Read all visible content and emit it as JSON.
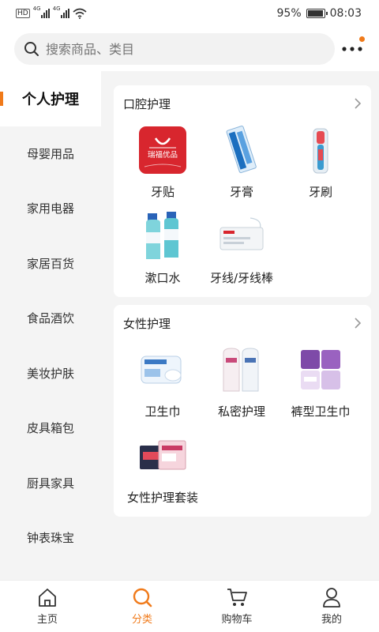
{
  "status": {
    "hd": "HD",
    "net1": "4G",
    "net2": "4G",
    "battery": "95%",
    "battery_level": 0.95,
    "time": "08:03"
  },
  "search": {
    "placeholder": "搜索商品、类目"
  },
  "sidebar": {
    "items": [
      {
        "label": "个人护理",
        "active": true
      },
      {
        "label": "母婴用品"
      },
      {
        "label": "家用电器"
      },
      {
        "label": "家居百货"
      },
      {
        "label": "食品酒饮"
      },
      {
        "label": "美妆护肤"
      },
      {
        "label": "皮具箱包"
      },
      {
        "label": "厨具家具"
      },
      {
        "label": "钟表珠宝"
      }
    ]
  },
  "sections": [
    {
      "title": "口腔护理",
      "items": [
        {
          "label": "牙贴",
          "icon": "tooth-strip-product-icon",
          "brand": "瑞福优品"
        },
        {
          "label": "牙膏",
          "icon": "toothpaste-product-icon"
        },
        {
          "label": "牙刷",
          "icon": "toothbrush-product-icon"
        },
        {
          "label": "漱口水",
          "icon": "mouthwash-product-icon"
        },
        {
          "label": "牙线/牙线棒",
          "icon": "dental-floss-product-icon"
        }
      ]
    },
    {
      "title": "女性护理",
      "items": [
        {
          "label": "卫生巾",
          "icon": "sanitary-pad-product-icon"
        },
        {
          "label": "私密护理",
          "icon": "intimate-care-product-icon"
        },
        {
          "label": "裤型卫生巾",
          "icon": "pants-pad-product-icon"
        },
        {
          "label": "女性护理套装",
          "icon": "care-set-product-icon"
        }
      ]
    }
  ],
  "tabs": [
    {
      "label": "主页",
      "icon": "home-icon"
    },
    {
      "label": "分类",
      "icon": "search-icon",
      "active": true
    },
    {
      "label": "购物车",
      "icon": "cart-icon"
    },
    {
      "label": "我的",
      "icon": "user-icon"
    }
  ],
  "colors": {
    "accent": "#f07a1a",
    "background": "#f4f4f4",
    "card": "#ffffff"
  }
}
